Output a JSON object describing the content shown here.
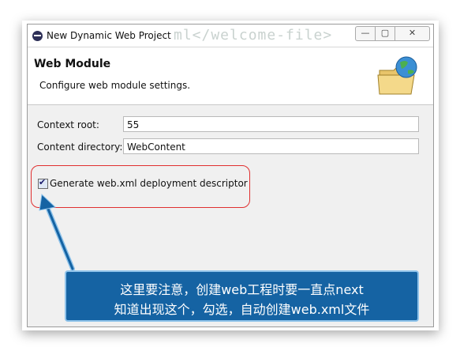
{
  "window": {
    "title": "New Dynamic Web Project",
    "ghost_text": "ml</welcome-file>",
    "controls": {
      "minimize": "—",
      "maximize": "▢",
      "close": "✕"
    }
  },
  "header": {
    "title": "Web Module",
    "description": "Configure web module settings."
  },
  "form": {
    "context_root_label": "Context root:",
    "context_root_value": "55",
    "content_directory_label": "Content directory:",
    "content_directory_value": "WebContent",
    "generate_webxml_label": "Generate web.xml deployment descriptor",
    "generate_webxml_checked": true
  },
  "annotation": {
    "line1": "这里要注意，创建web工程时要一直点next",
    "line2": "知道出现这个，勾选，自动创建web.xml文件",
    "highlight_color": "#e03030",
    "callout_color": "#1563a3"
  },
  "icons": {
    "app": "eclipse-icon",
    "wizard": "folder-globe-icon"
  }
}
